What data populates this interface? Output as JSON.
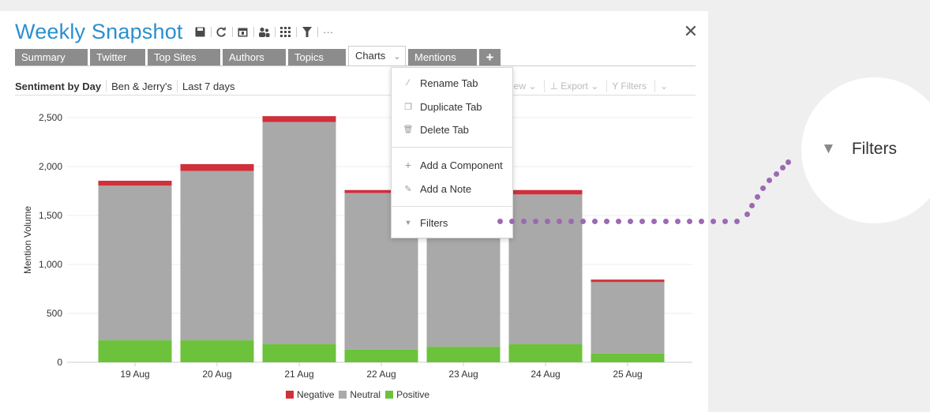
{
  "window": {
    "title": "Weekly Snapshot",
    "toolbar_icons": [
      "save-icon",
      "refresh-icon",
      "calendar-icon",
      "users-icon",
      "grid-icon",
      "filter-icon",
      "more-icon"
    ],
    "more_label": "···",
    "close_label": "✕"
  },
  "tabs": [
    {
      "label": "Summary",
      "active": false
    },
    {
      "label": "Twitter",
      "active": false
    },
    {
      "label": "Top Sites",
      "active": false
    },
    {
      "label": "Authors",
      "active": false
    },
    {
      "label": "Topics",
      "active": false
    },
    {
      "label": "Charts",
      "active": true,
      "chevron": "⌄"
    },
    {
      "label": "Mentions",
      "active": false
    }
  ],
  "add_tab_label": "+",
  "subheader": {
    "title": "Sentiment by Day",
    "brand": "Ben & Jerry's",
    "range": "Last 7 days"
  },
  "subheader_right": {
    "view": "iew ⌄",
    "export": "⊥ Export ⌄",
    "filters": "Y Filters",
    "more": "⌄"
  },
  "menu": {
    "items": [
      {
        "icon": "pencil-icon",
        "glyph": "∕",
        "label": "Rename Tab"
      },
      {
        "icon": "duplicate-icon",
        "glyph": "❐",
        "label": "Duplicate Tab"
      },
      {
        "icon": "trash-icon",
        "glyph": "🗑",
        "label": "Delete Tab"
      },
      {
        "icon": "plus-icon",
        "glyph": "+",
        "label": "Add a Component"
      },
      {
        "icon": "note-icon",
        "glyph": "✎",
        "label": "Add a Note"
      },
      {
        "icon": "filter-icon",
        "glyph": "▼",
        "label": "Filters"
      }
    ]
  },
  "callout": {
    "label": "Filters",
    "icon": "filter-icon",
    "glyph": "▼"
  },
  "colors": {
    "negative": "#d0303a",
    "neutral": "#a9a9a9",
    "positive": "#6cc23a",
    "title": "#2a8fd0",
    "dots": "#9b6ab3"
  },
  "chart_data": {
    "type": "bar",
    "stacked": true,
    "categories": [
      "19 Aug",
      "20 Aug",
      "21 Aug",
      "22 Aug",
      "23 Aug",
      "24 Aug",
      "25 Aug"
    ],
    "series": [
      {
        "name": "Negative",
        "values": [
          50,
          70,
          60,
          30,
          40,
          45,
          25
        ]
      },
      {
        "name": "Neutral",
        "values": [
          1580,
          1730,
          2270,
          1600,
          1560,
          1530,
          730
        ]
      },
      {
        "name": "Positive",
        "values": [
          225,
          225,
          185,
          130,
          160,
          185,
          90
        ]
      }
    ],
    "ylabel": "Mention Volume",
    "xlabel": "",
    "ylim": [
      0,
      2500
    ],
    "yticks": [
      0,
      500,
      1000,
      1500,
      2000,
      2500
    ],
    "ytick_labels": [
      "0",
      "500",
      "1,000",
      "1,500",
      "2,000",
      "2,500"
    ],
    "grid": true,
    "legend": "bottom-center"
  }
}
